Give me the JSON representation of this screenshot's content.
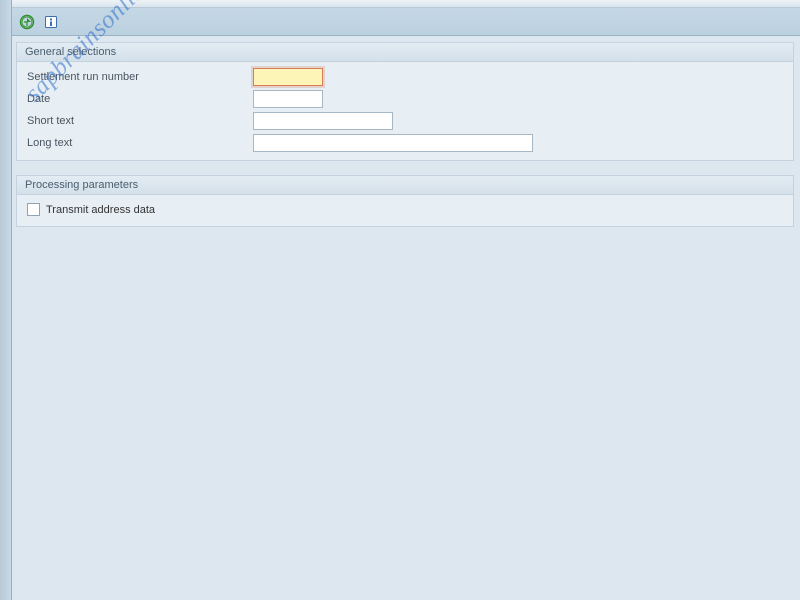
{
  "toolbar": {
    "execute_icon": "execute-icon",
    "info_icon": "info-icon"
  },
  "groups": {
    "general": {
      "title": "General selections",
      "fields": {
        "settlement_run": {
          "label": "Settlement run number",
          "value": ""
        },
        "date": {
          "label": "Date",
          "value": ""
        },
        "short_text": {
          "label": "Short text",
          "value": ""
        },
        "long_text": {
          "label": "Long text",
          "value": ""
        }
      }
    },
    "processing": {
      "title": "Processing parameters",
      "transmit": {
        "label": "Transmit address data",
        "checked": false
      }
    }
  },
  "watermark": "sapbrainsonline.com"
}
